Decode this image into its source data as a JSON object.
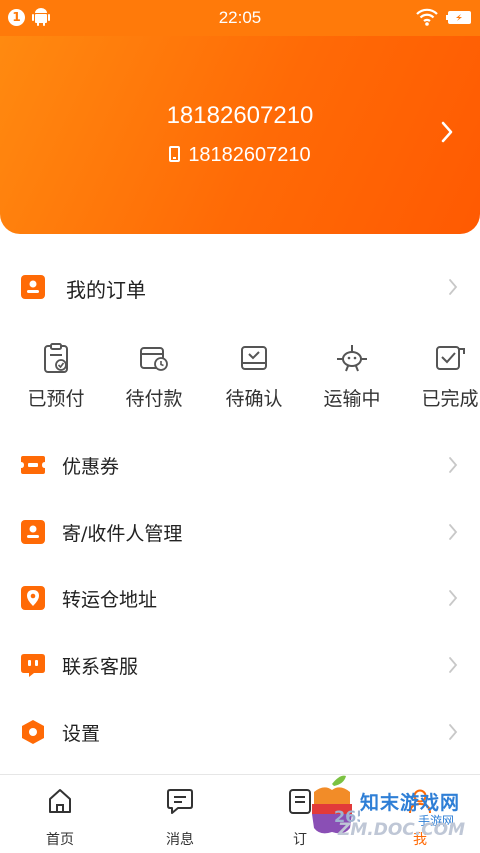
{
  "status_bar": {
    "notification_count": "1",
    "time": "22:05"
  },
  "profile": {
    "name": "18182607210",
    "phone": "18182607210"
  },
  "menu": {
    "my_orders": "我的订单",
    "coupons": "优惠券",
    "contacts": "寄/收件人管理",
    "warehouse_address": "转运仓地址",
    "customer_service": "联系客服",
    "settings": "设置"
  },
  "order_status": [
    {
      "label": "已预付",
      "icon": "clipboard-check-icon"
    },
    {
      "label": "待付款",
      "icon": "wallet-clock-icon"
    },
    {
      "label": "待确认",
      "icon": "box-check-icon"
    },
    {
      "label": "运输中",
      "icon": "airplane-icon"
    },
    {
      "label": "已完成",
      "icon": "checkbox-done-icon"
    }
  ],
  "tabs": [
    {
      "label": "首页",
      "icon": "home-icon"
    },
    {
      "label": "消息",
      "icon": "message-icon"
    },
    {
      "label": "订",
      "icon": "order-icon"
    },
    {
      "label": "我",
      "icon": "user-icon"
    }
  ],
  "watermark": {
    "line1": "知末游戏网",
    "line2": "手游网",
    "line3": "ZM.DOC.COM",
    "logo_number": "265"
  },
  "colors": {
    "accent": "#ff6a06",
    "header_start": "#ff8a10",
    "header_end": "#ff5a02"
  }
}
